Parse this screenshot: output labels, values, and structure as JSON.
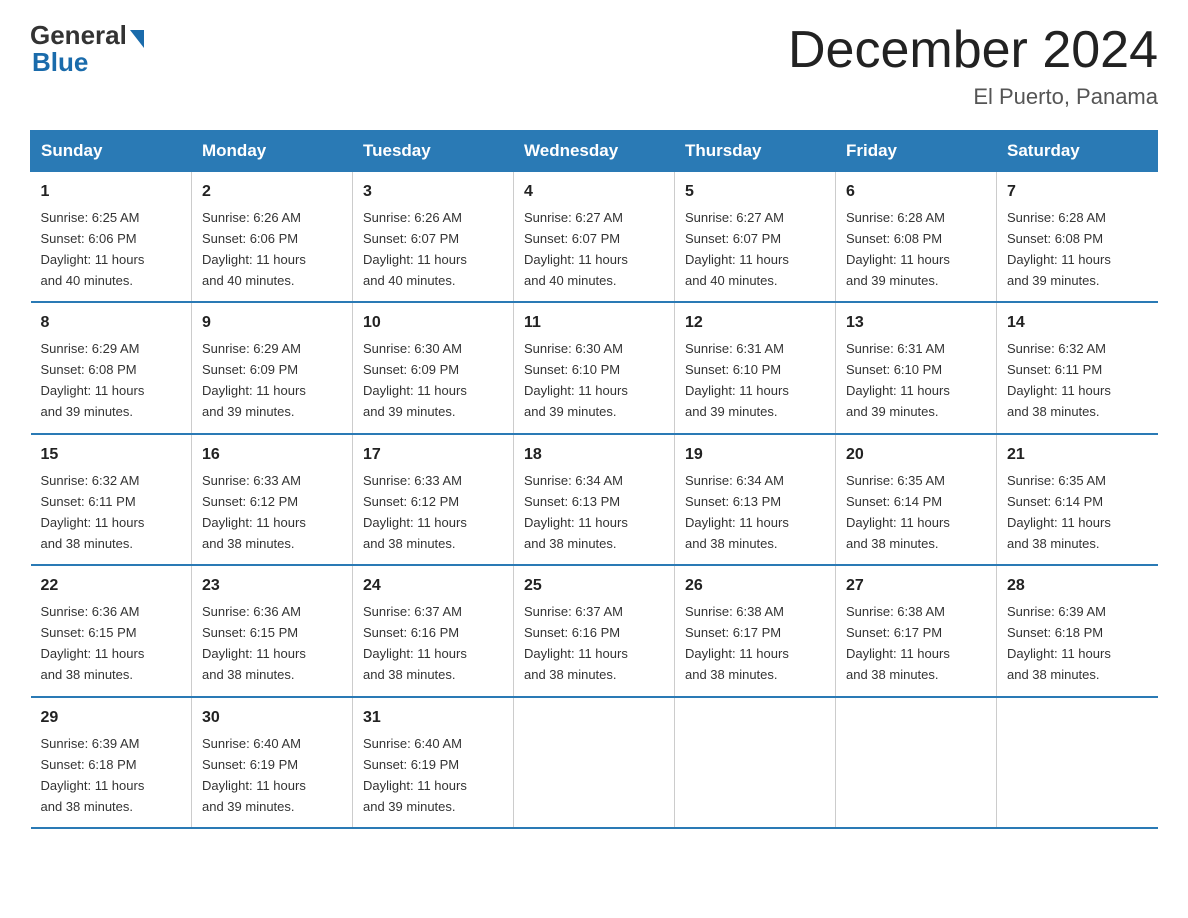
{
  "logo": {
    "general": "General",
    "blue": "Blue"
  },
  "header": {
    "month": "December 2024",
    "location": "El Puerto, Panama"
  },
  "weekdays": [
    "Sunday",
    "Monday",
    "Tuesday",
    "Wednesday",
    "Thursday",
    "Friday",
    "Saturday"
  ],
  "weeks": [
    [
      {
        "day": "1",
        "sunrise": "6:25 AM",
        "sunset": "6:06 PM",
        "daylight": "11 hours and 40 minutes."
      },
      {
        "day": "2",
        "sunrise": "6:26 AM",
        "sunset": "6:06 PM",
        "daylight": "11 hours and 40 minutes."
      },
      {
        "day": "3",
        "sunrise": "6:26 AM",
        "sunset": "6:07 PM",
        "daylight": "11 hours and 40 minutes."
      },
      {
        "day": "4",
        "sunrise": "6:27 AM",
        "sunset": "6:07 PM",
        "daylight": "11 hours and 40 minutes."
      },
      {
        "day": "5",
        "sunrise": "6:27 AM",
        "sunset": "6:07 PM",
        "daylight": "11 hours and 40 minutes."
      },
      {
        "day": "6",
        "sunrise": "6:28 AM",
        "sunset": "6:08 PM",
        "daylight": "11 hours and 39 minutes."
      },
      {
        "day": "7",
        "sunrise": "6:28 AM",
        "sunset": "6:08 PM",
        "daylight": "11 hours and 39 minutes."
      }
    ],
    [
      {
        "day": "8",
        "sunrise": "6:29 AM",
        "sunset": "6:08 PM",
        "daylight": "11 hours and 39 minutes."
      },
      {
        "day": "9",
        "sunrise": "6:29 AM",
        "sunset": "6:09 PM",
        "daylight": "11 hours and 39 minutes."
      },
      {
        "day": "10",
        "sunrise": "6:30 AM",
        "sunset": "6:09 PM",
        "daylight": "11 hours and 39 minutes."
      },
      {
        "day": "11",
        "sunrise": "6:30 AM",
        "sunset": "6:10 PM",
        "daylight": "11 hours and 39 minutes."
      },
      {
        "day": "12",
        "sunrise": "6:31 AM",
        "sunset": "6:10 PM",
        "daylight": "11 hours and 39 minutes."
      },
      {
        "day": "13",
        "sunrise": "6:31 AM",
        "sunset": "6:10 PM",
        "daylight": "11 hours and 39 minutes."
      },
      {
        "day": "14",
        "sunrise": "6:32 AM",
        "sunset": "6:11 PM",
        "daylight": "11 hours and 38 minutes."
      }
    ],
    [
      {
        "day": "15",
        "sunrise": "6:32 AM",
        "sunset": "6:11 PM",
        "daylight": "11 hours and 38 minutes."
      },
      {
        "day": "16",
        "sunrise": "6:33 AM",
        "sunset": "6:12 PM",
        "daylight": "11 hours and 38 minutes."
      },
      {
        "day": "17",
        "sunrise": "6:33 AM",
        "sunset": "6:12 PM",
        "daylight": "11 hours and 38 minutes."
      },
      {
        "day": "18",
        "sunrise": "6:34 AM",
        "sunset": "6:13 PM",
        "daylight": "11 hours and 38 minutes."
      },
      {
        "day": "19",
        "sunrise": "6:34 AM",
        "sunset": "6:13 PM",
        "daylight": "11 hours and 38 minutes."
      },
      {
        "day": "20",
        "sunrise": "6:35 AM",
        "sunset": "6:14 PM",
        "daylight": "11 hours and 38 minutes."
      },
      {
        "day": "21",
        "sunrise": "6:35 AM",
        "sunset": "6:14 PM",
        "daylight": "11 hours and 38 minutes."
      }
    ],
    [
      {
        "day": "22",
        "sunrise": "6:36 AM",
        "sunset": "6:15 PM",
        "daylight": "11 hours and 38 minutes."
      },
      {
        "day": "23",
        "sunrise": "6:36 AM",
        "sunset": "6:15 PM",
        "daylight": "11 hours and 38 minutes."
      },
      {
        "day": "24",
        "sunrise": "6:37 AM",
        "sunset": "6:16 PM",
        "daylight": "11 hours and 38 minutes."
      },
      {
        "day": "25",
        "sunrise": "6:37 AM",
        "sunset": "6:16 PM",
        "daylight": "11 hours and 38 minutes."
      },
      {
        "day": "26",
        "sunrise": "6:38 AM",
        "sunset": "6:17 PM",
        "daylight": "11 hours and 38 minutes."
      },
      {
        "day": "27",
        "sunrise": "6:38 AM",
        "sunset": "6:17 PM",
        "daylight": "11 hours and 38 minutes."
      },
      {
        "day": "28",
        "sunrise": "6:39 AM",
        "sunset": "6:18 PM",
        "daylight": "11 hours and 38 minutes."
      }
    ],
    [
      {
        "day": "29",
        "sunrise": "6:39 AM",
        "sunset": "6:18 PM",
        "daylight": "11 hours and 38 minutes."
      },
      {
        "day": "30",
        "sunrise": "6:40 AM",
        "sunset": "6:19 PM",
        "daylight": "11 hours and 39 minutes."
      },
      {
        "day": "31",
        "sunrise": "6:40 AM",
        "sunset": "6:19 PM",
        "daylight": "11 hours and 39 minutes."
      },
      null,
      null,
      null,
      null
    ]
  ],
  "labels": {
    "sunrise": "Sunrise:",
    "sunset": "Sunset:",
    "daylight": "Daylight:"
  }
}
